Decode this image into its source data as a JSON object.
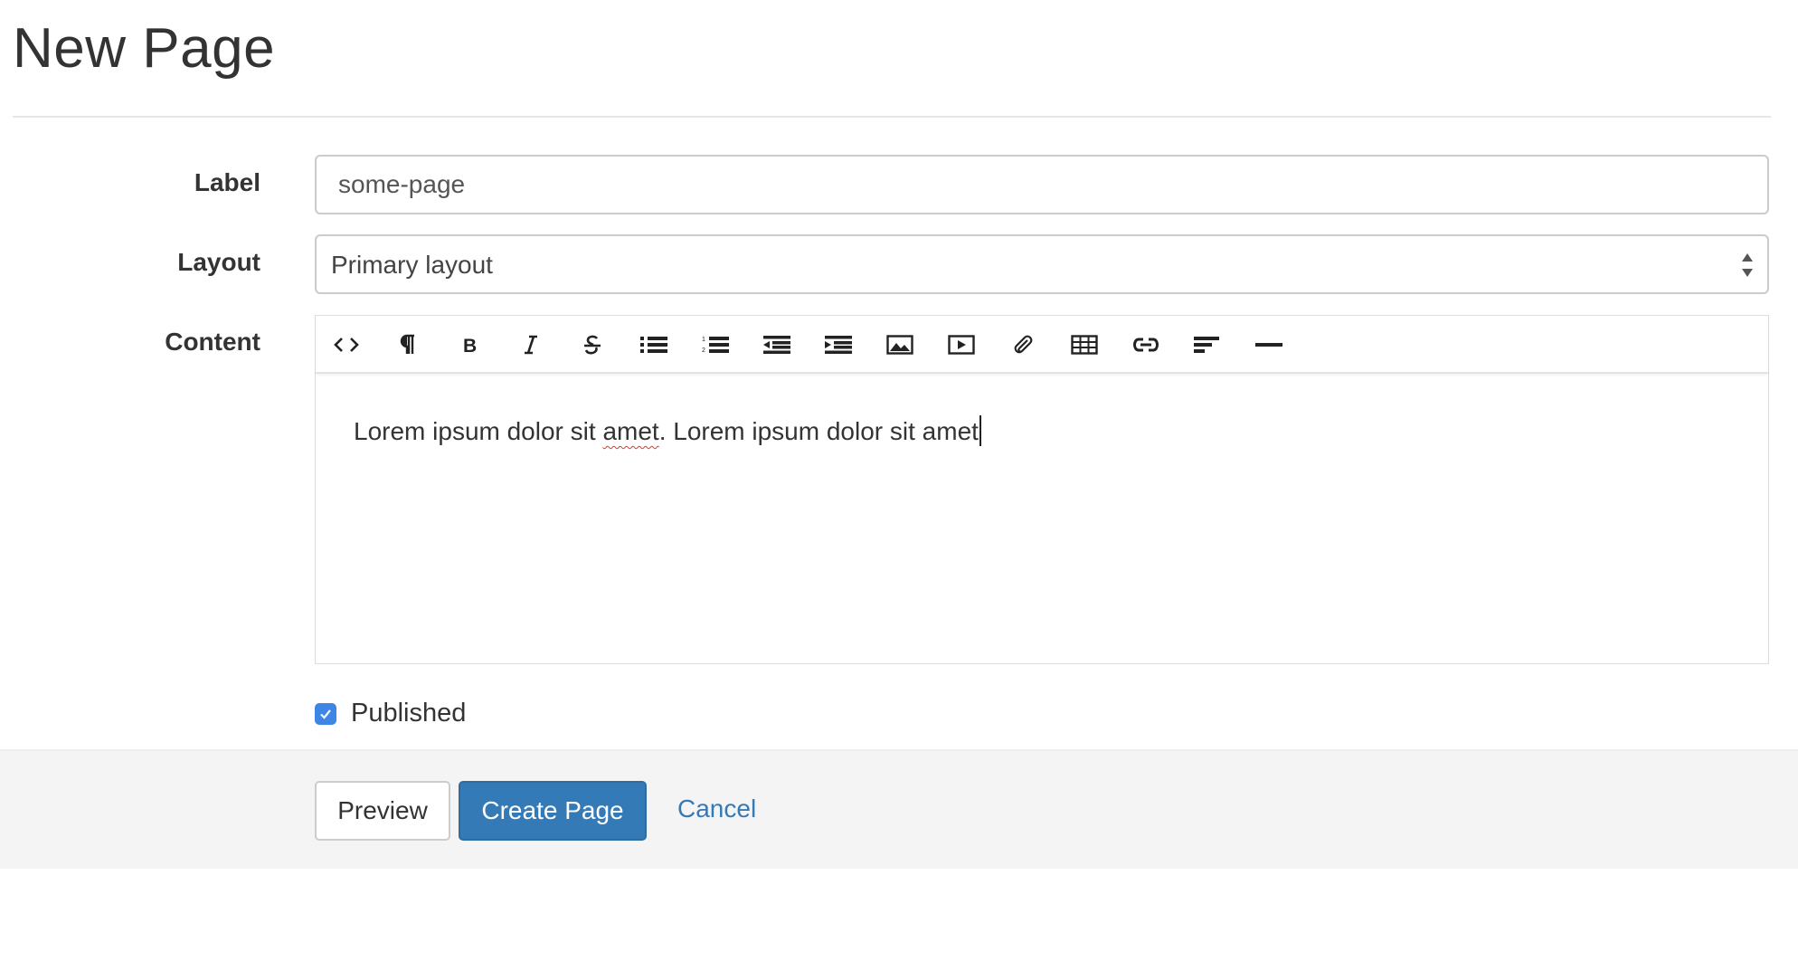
{
  "page": {
    "title": "New Page"
  },
  "form": {
    "label": {
      "caption": "Label",
      "value": "some-page"
    },
    "layout": {
      "caption": "Layout",
      "selected": "Primary layout"
    },
    "content": {
      "caption": "Content",
      "text_before": "Lorem ipsum dolor sit ",
      "misspelled": "amet",
      "text_after": ". Lorem ipsum dolor sit amet",
      "toolbar": [
        {
          "name": "html",
          "icon": "code-icon"
        },
        {
          "name": "formatting",
          "icon": "paragraph-icon"
        },
        {
          "name": "bold",
          "icon": "bold-icon"
        },
        {
          "name": "italic",
          "icon": "italic-icon"
        },
        {
          "name": "deleted",
          "icon": "strikethrough-icon"
        },
        {
          "name": "unorderedlist",
          "icon": "bullet-list-icon"
        },
        {
          "name": "orderedlist",
          "icon": "numbered-list-icon"
        },
        {
          "name": "outdent",
          "icon": "outdent-icon"
        },
        {
          "name": "indent",
          "icon": "indent-icon"
        },
        {
          "name": "image",
          "icon": "image-icon"
        },
        {
          "name": "video",
          "icon": "video-icon"
        },
        {
          "name": "file",
          "icon": "paperclip-icon"
        },
        {
          "name": "table",
          "icon": "table-icon"
        },
        {
          "name": "link",
          "icon": "link-icon"
        },
        {
          "name": "alignment",
          "icon": "align-left-icon"
        },
        {
          "name": "horizontalrule",
          "icon": "horizontal-rule-icon"
        }
      ]
    },
    "published": {
      "caption": "Published",
      "checked": true
    }
  },
  "actions": {
    "preview_label": "Preview",
    "create_label": "Create Page",
    "cancel_label": "Cancel"
  },
  "colors": {
    "primary": "#337ab7",
    "checkbox": "#3e86e6",
    "footer_bg": "#f4f4f4",
    "spellcheck": "#e0362b"
  }
}
